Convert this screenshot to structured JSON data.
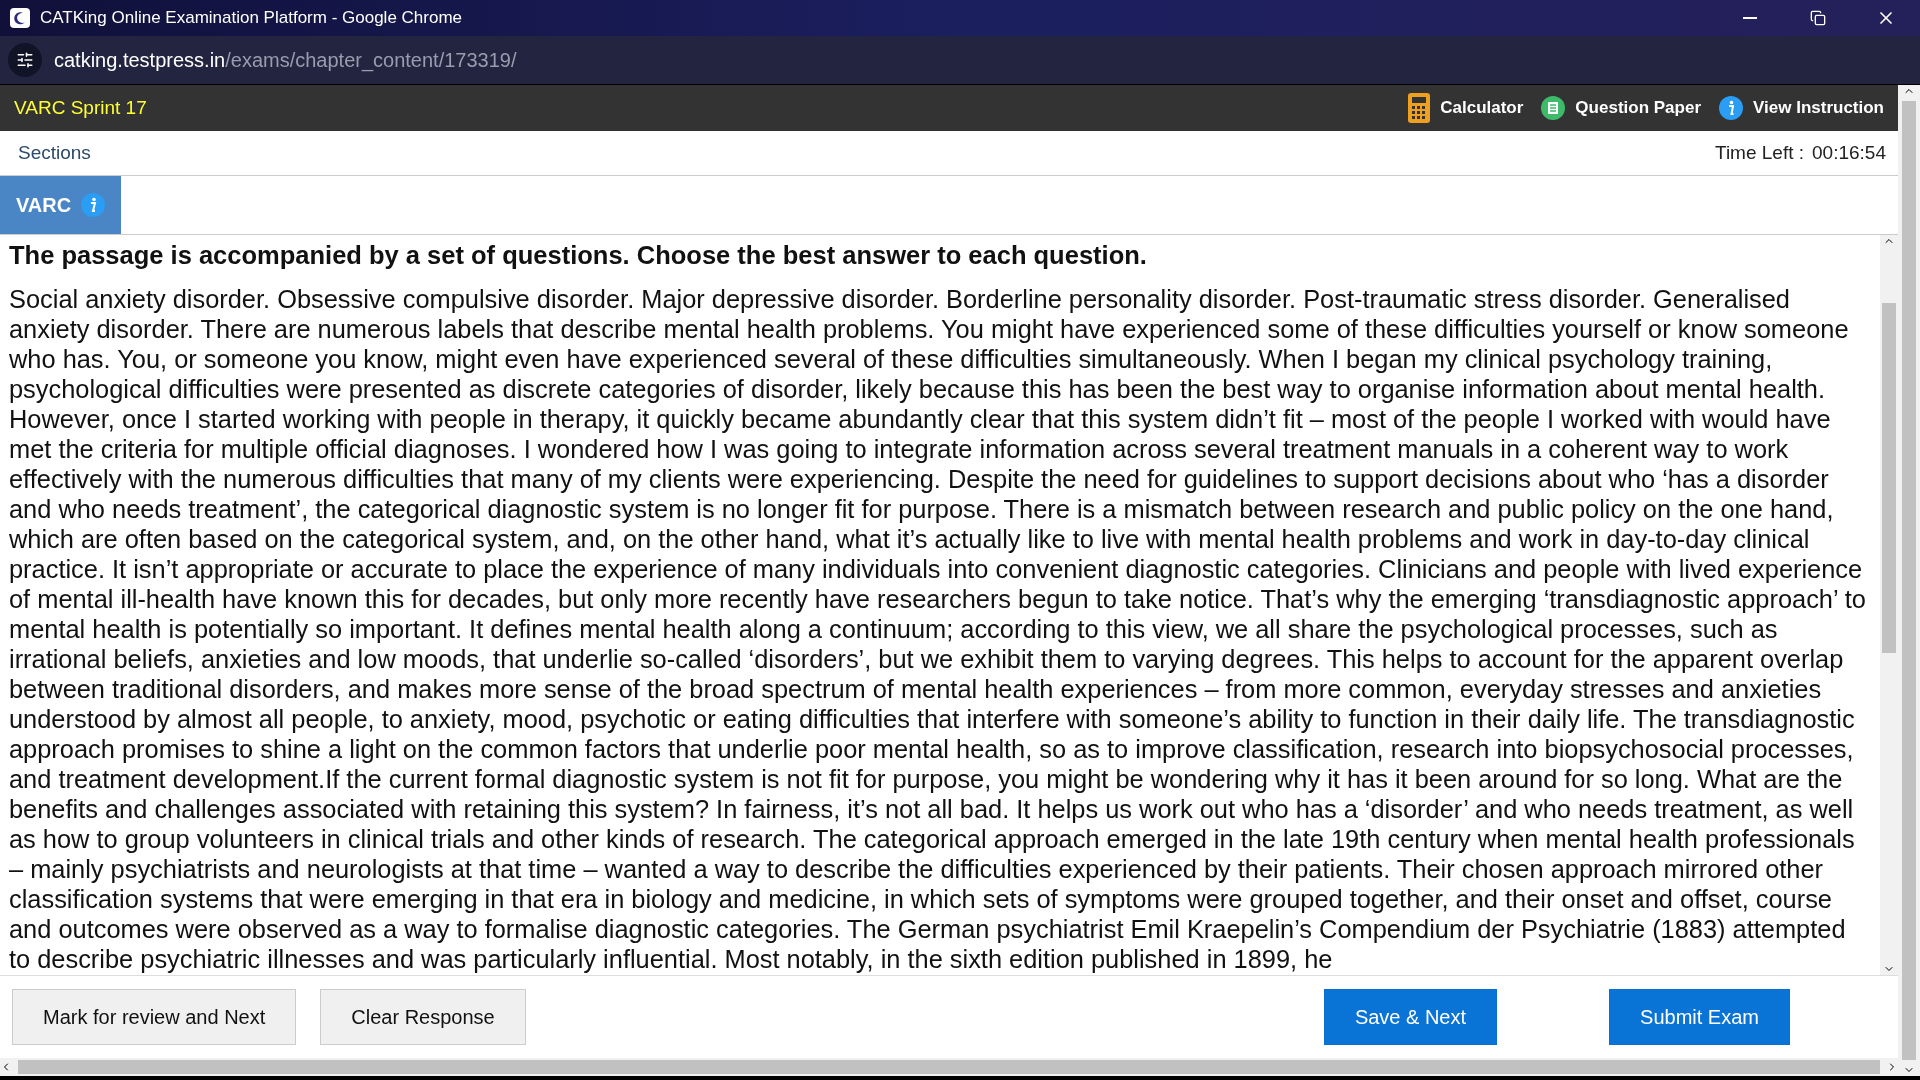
{
  "window": {
    "title": "CATKing Online Examination Platform - Google Chrome"
  },
  "address_bar": {
    "domain": "catking.testpress.in",
    "path": "/exams/chapter_content/173319/"
  },
  "header": {
    "title": "VARC Sprint 17",
    "tools": [
      {
        "kind": "calculator",
        "label": "Calculator"
      },
      {
        "kind": "paper",
        "label": "Question Paper"
      },
      {
        "kind": "info",
        "label": "View Instruction"
      }
    ]
  },
  "sections_bar": {
    "label": "Sections",
    "time_label": "Time Left :",
    "time_value": "00:16:54"
  },
  "section_tabs": [
    {
      "label": "VARC",
      "selected": true
    }
  ],
  "passage": {
    "instruction": "The passage is accompanied by a set of questions. Choose the best answer to each question.",
    "text": "Social anxiety disorder. Obsessive compulsive disorder. Major depressive disorder. Borderline personality disorder. Post-traumatic stress disorder. Generalised anxiety disorder. There are numerous labels that describe mental health problems. You might have experienced some of these difficulties yourself or know someone who has. You, or someone you know, might even have experienced several of these difficulties simultaneously. When I began my clinical psychology training, psychological difficulties were presented as discrete categories of disorder, likely because this has been the best way to organise information about mental health. However, once I started working with people in therapy, it quickly became abundantly clear that this system didn’t fit – most of the people I worked with would have met the criteria for multiple official diagnoses. I wondered how I was going to integrate information across several treatment manuals in a coherent way to work effectively with the numerous difficulties that many of my clients were experiencing. Despite the need for guidelines to support decisions about who ‘has a disorder and who needs treatment’, the categorical diagnostic system is no longer fit for purpose. There is a mismatch between research and public policy on the one hand, which are often based on the categorical system, and, on the other hand, what it’s actually like to live with mental health problems and work in day-to-day clinical practice. It isn’t appropriate or accurate to place the experience of many individuals into convenient diagnostic categories. Clinicians and people with lived experience of mental ill-health have known this for decades, but only more recently have researchers begun to take notice. That’s why the emerging ‘transdiagnostic approach’ to mental health is potentially so important. It defines mental health along a continuum; according to this view, we all share the psychological processes, such as irrational beliefs, anxieties and low moods, that underlie so-called ‘disorders’, but we exhibit them to varying degrees. This helps to account for the apparent overlap between traditional disorders, and makes more sense of the broad spectrum of mental health experiences – from more common, everyday stresses and anxieties understood by almost all people, to anxiety, mood, psychotic or eating difficulties that interfere with someone’s ability to function in their daily life. The transdiagnostic approach promises to shine a light on the common factors that underlie poor mental health, so as to improve classification, research into biopsychosocial processes, and treatment development.If the current formal diagnostic system is not fit for purpose, you might be wondering why it has it been around for so long. What are the benefits and challenges associated with retaining this system? In fairness, it’s not all bad. It helps us work out who has a ‘disorder’ and who needs treatment, as well as how to group volunteers in clinical trials and other kinds of research. The categorical approach emerged in the late 19th century when mental health professionals – mainly psychiatrists and neurologists at that time – wanted a way to describe the difficulties experienced by their patients. Their chosen approach mirrored other classification systems that were emerging in that era in biology and medicine, in which sets of symptoms were grouped together, and their onset and offset, course and outcomes were observed as a way to formalise diagnostic categories. The German psychiatrist Emil Kraepelin’s Compendium der Psychiatrie (1883) attempted to describe psychiatric illnesses and was particularly influential. Most notably, in the sixth edition published in 1899, he"
  },
  "actions": [
    {
      "kind": "secondary",
      "label": "Mark for review and Next"
    },
    {
      "kind": "secondary",
      "label": "Clear Response"
    },
    {
      "kind": "primary",
      "label": "Save & Next"
    },
    {
      "kind": "submit",
      "label": "Submit Exam"
    }
  ]
}
